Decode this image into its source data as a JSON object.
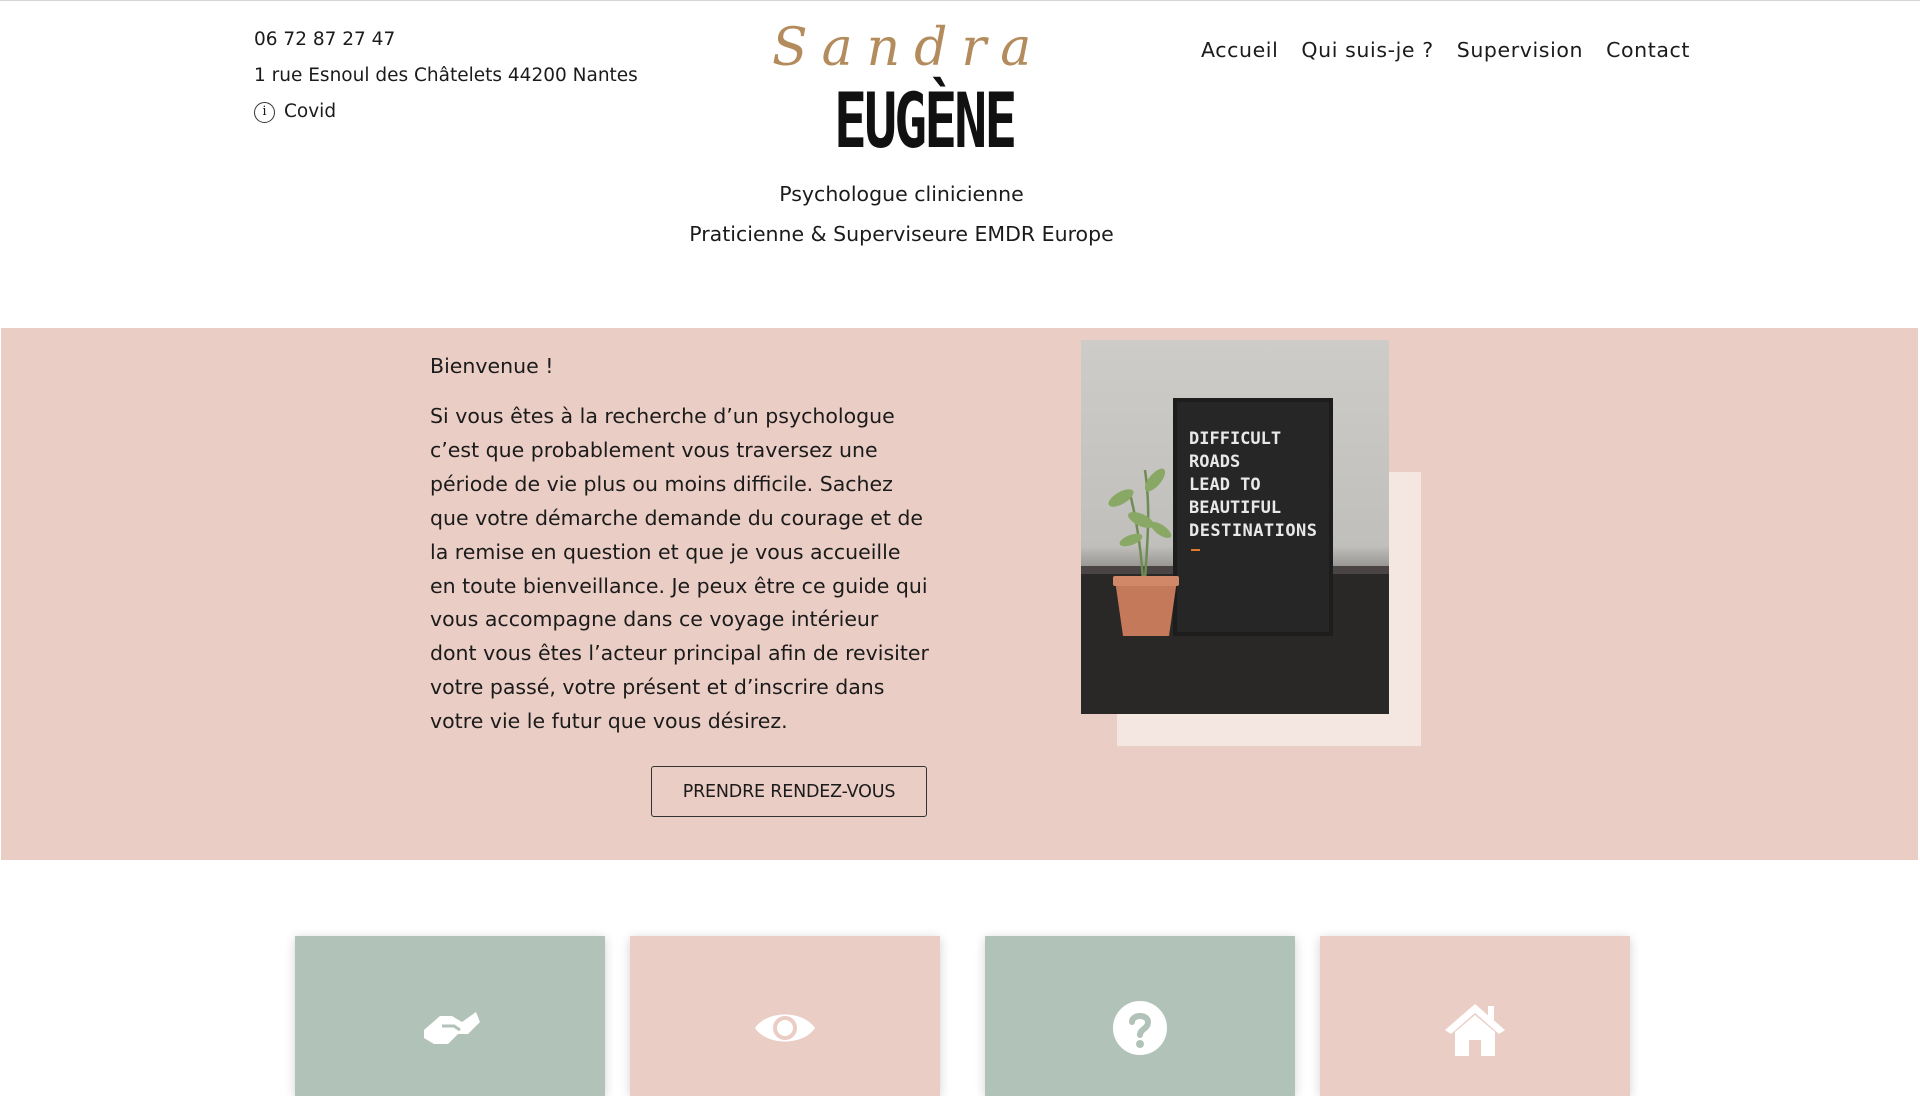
{
  "header": {
    "phone": "06 72 87 27 47",
    "address": "1 rue Esnoul des Châtelets 44200 Nantes",
    "covid_label": "Covid",
    "logo_script": "Sandra",
    "logo_name": "EUGÈNE",
    "tagline_1": "Psychologue clinicienne",
    "tagline_2": "Praticienne & Superviseure EMDR Europe"
  },
  "nav": {
    "items": [
      {
        "label": "Accueil"
      },
      {
        "label": "Qui suis-je ?"
      },
      {
        "label": "Supervision"
      },
      {
        "label": "Contact"
      }
    ]
  },
  "hero": {
    "welcome": "Bienvenue !",
    "intro": "Si vous êtes à la recherche d’un psychologue c’est que probablement vous traversez une période de vie plus ou moins difficile. Sachez que votre démarche demande du courage et de la remise en question et que je vous accueille en toute bienveillance. Je peux être ce guide qui vous accompagne dans ce voyage intérieur dont vous êtes l’acteur principal afin de revisiter votre passé, votre présent et d’inscrire dans votre vie le futur que vous désirez.",
    "cta_label": "PRENDRE RENDEZ-VOUS",
    "photo_text": [
      "DIFFICULT",
      "ROADS",
      "LEAD TO",
      "BEAUTIFUL",
      "DESTINATIONS"
    ]
  },
  "cards": [
    {
      "icon": "handshake-icon",
      "color": "#b1c3b9"
    },
    {
      "icon": "eye-icon",
      "color": "#eacdc4"
    },
    {
      "icon": "question-circle-icon",
      "color": "#b1c3b9"
    },
    {
      "icon": "home-icon",
      "color": "#eacdc4"
    }
  ],
  "colors": {
    "pink": "#eacdc4",
    "sage": "#b1c3b9",
    "gold": "#b38b5d",
    "text": "#1b1b1b"
  }
}
